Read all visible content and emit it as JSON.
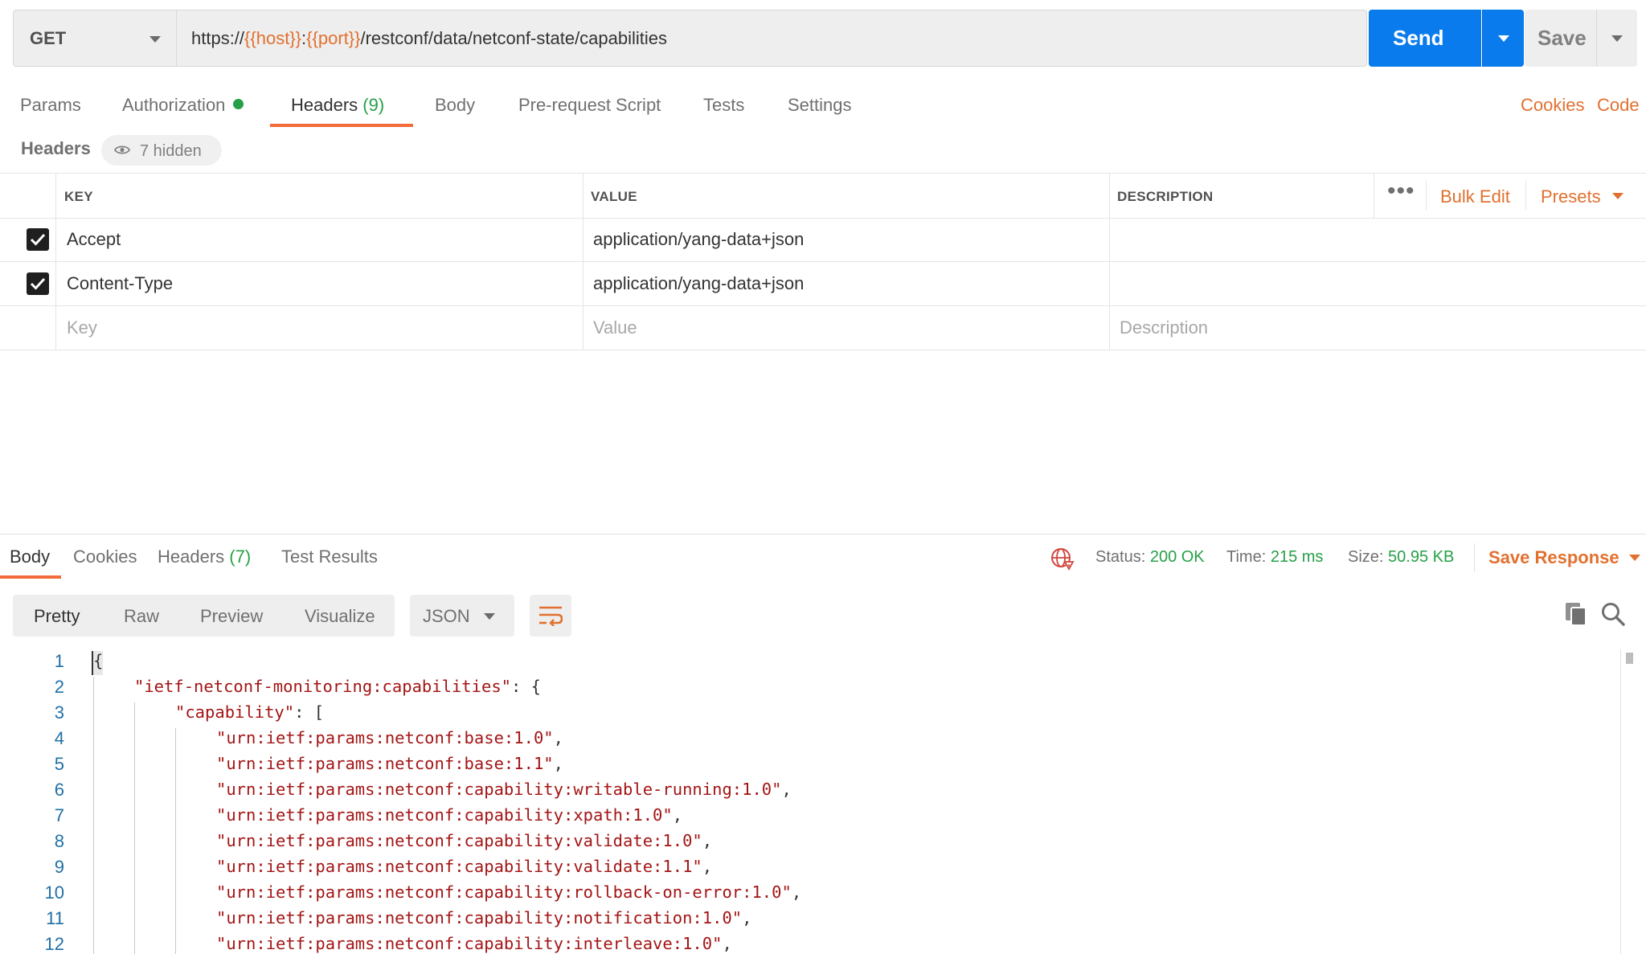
{
  "request": {
    "method": "GET",
    "url_parts": [
      {
        "text": "https://",
        "var": false
      },
      {
        "text": "{{host}}",
        "var": true
      },
      {
        "text": ":",
        "var": false
      },
      {
        "text": "{{port}}",
        "var": true
      },
      {
        "text": "/restconf/data/netconf-state/capabilities",
        "var": false
      }
    ],
    "send_label": "Send",
    "save_label": "Save"
  },
  "request_tabs": {
    "params": "Params",
    "authorization": "Authorization",
    "headers": "Headers",
    "headers_count": "(9)",
    "body": "Body",
    "pre_request": "Pre-request Script",
    "tests": "Tests",
    "settings": "Settings",
    "cookies_link": "Cookies",
    "code_link": "Code"
  },
  "headers_section": {
    "title": "Headers",
    "hidden_label": "7 hidden",
    "columns": {
      "key": "KEY",
      "value": "VALUE",
      "description": "DESCRIPTION"
    },
    "bulk_edit": "Bulk Edit",
    "presets": "Presets",
    "rows": [
      {
        "checked": true,
        "key": "Accept",
        "value": "application/yang-data+json",
        "description": ""
      },
      {
        "checked": true,
        "key": "Content-Type",
        "value": "application/yang-data+json",
        "description": ""
      }
    ],
    "placeholders": {
      "key": "Key",
      "value": "Value",
      "description": "Description"
    }
  },
  "response": {
    "tabs": {
      "body": "Body",
      "cookies": "Cookies",
      "headers": "Headers",
      "headers_count": "(7)",
      "test_results": "Test Results"
    },
    "status_label": "Status:",
    "status_value": "200 OK",
    "time_label": "Time:",
    "time_value": "215 ms",
    "size_label": "Size:",
    "size_value": "50.95 KB",
    "save_response": "Save Response",
    "view_modes": {
      "pretty": "Pretty",
      "raw": "Raw",
      "preview": "Preview",
      "visualize": "Visualize"
    },
    "format": "JSON",
    "code_lines": [
      {
        "n": "1",
        "indent": 0,
        "str": "",
        "tail": "{"
      },
      {
        "n": "2",
        "indent": 1,
        "str": "\"ietf-netconf-monitoring:capabilities\"",
        "tail": ": {"
      },
      {
        "n": "3",
        "indent": 2,
        "str": "\"capability\"",
        "tail": ": ["
      },
      {
        "n": "4",
        "indent": 3,
        "str": "\"urn:ietf:params:netconf:base:1.0\"",
        "tail": ","
      },
      {
        "n": "5",
        "indent": 3,
        "str": "\"urn:ietf:params:netconf:base:1.1\"",
        "tail": ","
      },
      {
        "n": "6",
        "indent": 3,
        "str": "\"urn:ietf:params:netconf:capability:writable-running:1.0\"",
        "tail": ","
      },
      {
        "n": "7",
        "indent": 3,
        "str": "\"urn:ietf:params:netconf:capability:xpath:1.0\"",
        "tail": ","
      },
      {
        "n": "8",
        "indent": 3,
        "str": "\"urn:ietf:params:netconf:capability:validate:1.0\"",
        "tail": ","
      },
      {
        "n": "9",
        "indent": 3,
        "str": "\"urn:ietf:params:netconf:capability:validate:1.1\"",
        "tail": ","
      },
      {
        "n": "10",
        "indent": 3,
        "str": "\"urn:ietf:params:netconf:capability:rollback-on-error:1.0\"",
        "tail": ","
      },
      {
        "n": "11",
        "indent": 3,
        "str": "\"urn:ietf:params:netconf:capability:notification:1.0\"",
        "tail": ","
      },
      {
        "n": "12",
        "indent": 3,
        "str": "\"urn:ietf:params:netconf:capability:interleave:1.0\"",
        "tail": ","
      }
    ]
  },
  "colors": {
    "accent_orange": "#e2702f",
    "send_blue": "#097bed",
    "status_green": "#26a047",
    "json_string": "#a31515",
    "line_number": "#2070a6"
  },
  "icons": [
    "chevron-down-icon",
    "green-dot-icon",
    "eye-icon",
    "checkbox-icon",
    "more-dots-icon",
    "globe-icon",
    "wrap-lines-icon",
    "copy-icon",
    "search-icon"
  ]
}
